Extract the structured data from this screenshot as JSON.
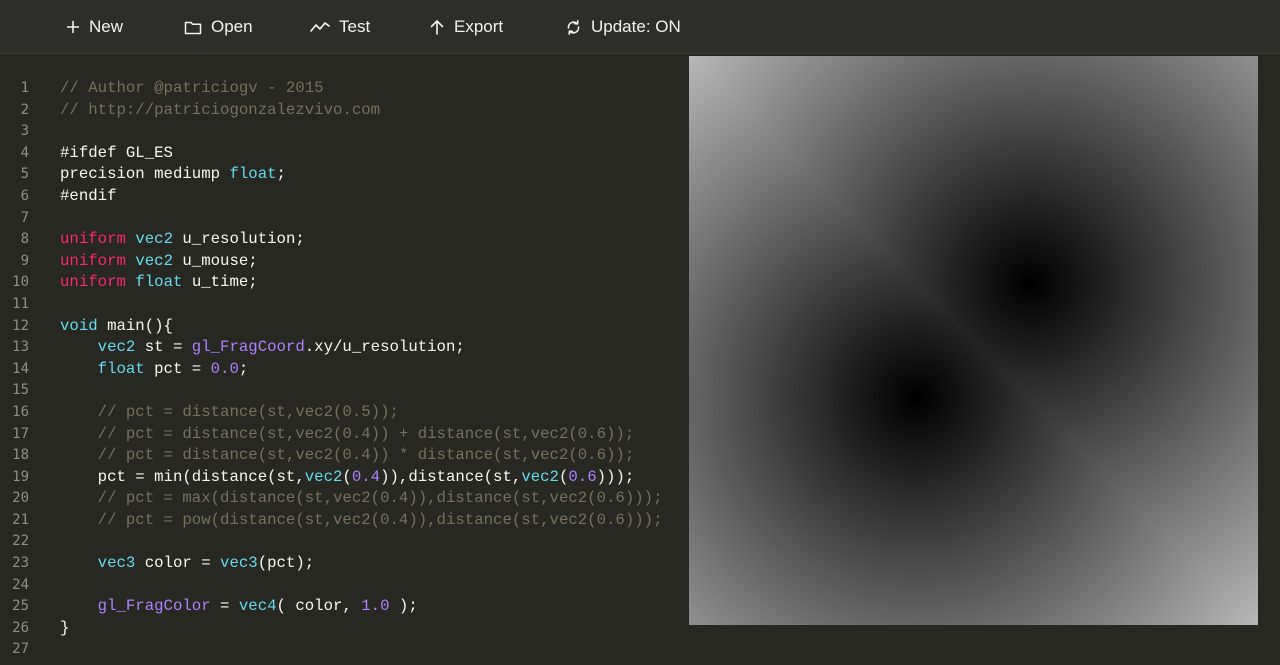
{
  "toolbar": {
    "new_label": "New",
    "open_label": "Open",
    "test_label": "Test",
    "export_label": "Export",
    "update_label": "Update: ON"
  },
  "editor": {
    "lines": [
      [
        {
          "t": "// Author @patriciogv - 2015",
          "c": "com"
        }
      ],
      [
        {
          "t": "// http://patriciogonzalezvivo.com",
          "c": "com"
        }
      ],
      [],
      [
        {
          "t": "#ifdef GL_ES",
          "c": "n"
        }
      ],
      [
        {
          "t": "precision mediump ",
          "c": "n"
        },
        {
          "t": "float",
          "c": "ty"
        },
        {
          "t": ";",
          "c": "n"
        }
      ],
      [
        {
          "t": "#endif",
          "c": "n"
        }
      ],
      [],
      [
        {
          "t": "uniform",
          "c": "kw"
        },
        {
          "t": " ",
          "c": "n"
        },
        {
          "t": "vec2",
          "c": "ty"
        },
        {
          "t": " u_resolution;",
          "c": "n"
        }
      ],
      [
        {
          "t": "uniform",
          "c": "kw"
        },
        {
          "t": " ",
          "c": "n"
        },
        {
          "t": "vec2",
          "c": "ty"
        },
        {
          "t": " u_mouse;",
          "c": "n"
        }
      ],
      [
        {
          "t": "uniform",
          "c": "kw"
        },
        {
          "t": " ",
          "c": "n"
        },
        {
          "t": "float",
          "c": "ty"
        },
        {
          "t": " u_time;",
          "c": "n"
        }
      ],
      [],
      [
        {
          "t": "void",
          "c": "ty"
        },
        {
          "t": " main(){",
          "c": "n"
        }
      ],
      [
        {
          "t": "    ",
          "c": "n"
        },
        {
          "t": "vec2",
          "c": "ty"
        },
        {
          "t": " st = ",
          "c": "n"
        },
        {
          "t": "gl_FragCoord",
          "c": "bi"
        },
        {
          "t": ".xy/u_resolution;",
          "c": "n"
        }
      ],
      [
        {
          "t": "    ",
          "c": "n"
        },
        {
          "t": "float",
          "c": "ty"
        },
        {
          "t": " pct = ",
          "c": "n"
        },
        {
          "t": "0.0",
          "c": "num"
        },
        {
          "t": ";",
          "c": "n"
        }
      ],
      [],
      [
        {
          "t": "    // pct = distance(st,vec2(0.5));",
          "c": "com"
        }
      ],
      [
        {
          "t": "    // pct = distance(st,vec2(0.4)) + distance(st,vec2(0.6));",
          "c": "com"
        }
      ],
      [
        {
          "t": "    // pct = distance(st,vec2(0.4)) * distance(st,vec2(0.6));",
          "c": "com"
        }
      ],
      [
        {
          "t": "    pct = min(distance(st,",
          "c": "n"
        },
        {
          "t": "vec2",
          "c": "ty"
        },
        {
          "t": "(",
          "c": "n"
        },
        {
          "t": "0.4",
          "c": "num"
        },
        {
          "t": ")),distance(st,",
          "c": "n"
        },
        {
          "t": "vec2",
          "c": "ty"
        },
        {
          "t": "(",
          "c": "n"
        },
        {
          "t": "0.6",
          "c": "num"
        },
        {
          "t": ")));",
          "c": "n"
        }
      ],
      [
        {
          "t": "    // pct = max(distance(st,vec2(0.4)),distance(st,vec2(0.6)));",
          "c": "com"
        }
      ],
      [
        {
          "t": "    // pct = pow(distance(st,vec2(0.4)),distance(st,vec2(0.6)));",
          "c": "com"
        }
      ],
      [],
      [
        {
          "t": "    ",
          "c": "n"
        },
        {
          "t": "vec3",
          "c": "ty"
        },
        {
          "t": " color = ",
          "c": "n"
        },
        {
          "t": "vec3",
          "c": "ty"
        },
        {
          "t": "(pct);",
          "c": "n"
        }
      ],
      [],
      [
        {
          "t": "    ",
          "c": "n"
        },
        {
          "t": "gl_FragColor",
          "c": "bi"
        },
        {
          "t": " = ",
          "c": "n"
        },
        {
          "t": "vec4",
          "c": "ty"
        },
        {
          "t": "( color, ",
          "c": "n"
        },
        {
          "t": "1.0",
          "c": "num"
        },
        {
          "t": " );",
          "c": "n"
        }
      ],
      [
        {
          "t": "}",
          "c": "n"
        }
      ],
      []
    ]
  },
  "preview": {
    "shader_min_distance_points": [
      [
        0.4,
        0.4
      ],
      [
        0.6,
        0.6
      ]
    ]
  },
  "icons": {
    "new": "plus-icon",
    "open": "folder-icon",
    "test": "line-chart-icon",
    "export": "arrow-up-icon",
    "update": "refresh-icon"
  },
  "colors": {
    "editor_bg": "#272822",
    "toolbar_bg": "#2d2d2a",
    "comment": "#75715e",
    "keyword": "#f92672",
    "type": "#66d9ef",
    "number": "#ae81ff",
    "text": "#f8f8f2"
  }
}
